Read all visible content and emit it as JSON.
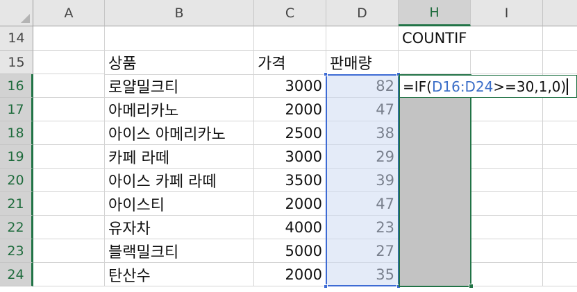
{
  "columns": [
    "A",
    "B",
    "C",
    "D",
    "H",
    "I",
    ""
  ],
  "rows": [
    "14",
    "15",
    "16",
    "17",
    "18",
    "19",
    "20",
    "21",
    "22",
    "23",
    "24"
  ],
  "h14": "COUNTIF",
  "headers": {
    "product": "상품",
    "price": "가격",
    "qty": "판매량"
  },
  "products": [
    "로얄밀크티",
    "아메리카노",
    "아이스 아메리카노",
    "카페 라떼",
    "아이스 카페 라떼",
    "아이스티",
    "유자차",
    "블랙밀크티",
    "탄산수"
  ],
  "prices": [
    "3000",
    "2000",
    "2500",
    "3000",
    "3500",
    "2000",
    "4000",
    "5000",
    "2000"
  ],
  "sales": [
    "82",
    "47",
    "38",
    "29",
    "39",
    "47",
    "23",
    "27",
    "35"
  ],
  "formula": {
    "prefix": "=IF(",
    "range": "D16:D24",
    "suffix": ">=30,1,0)"
  },
  "colors": {
    "selection_green": "#217346",
    "range_blue": "#3d6bd4",
    "ref_blue": "#3c6fc8"
  }
}
